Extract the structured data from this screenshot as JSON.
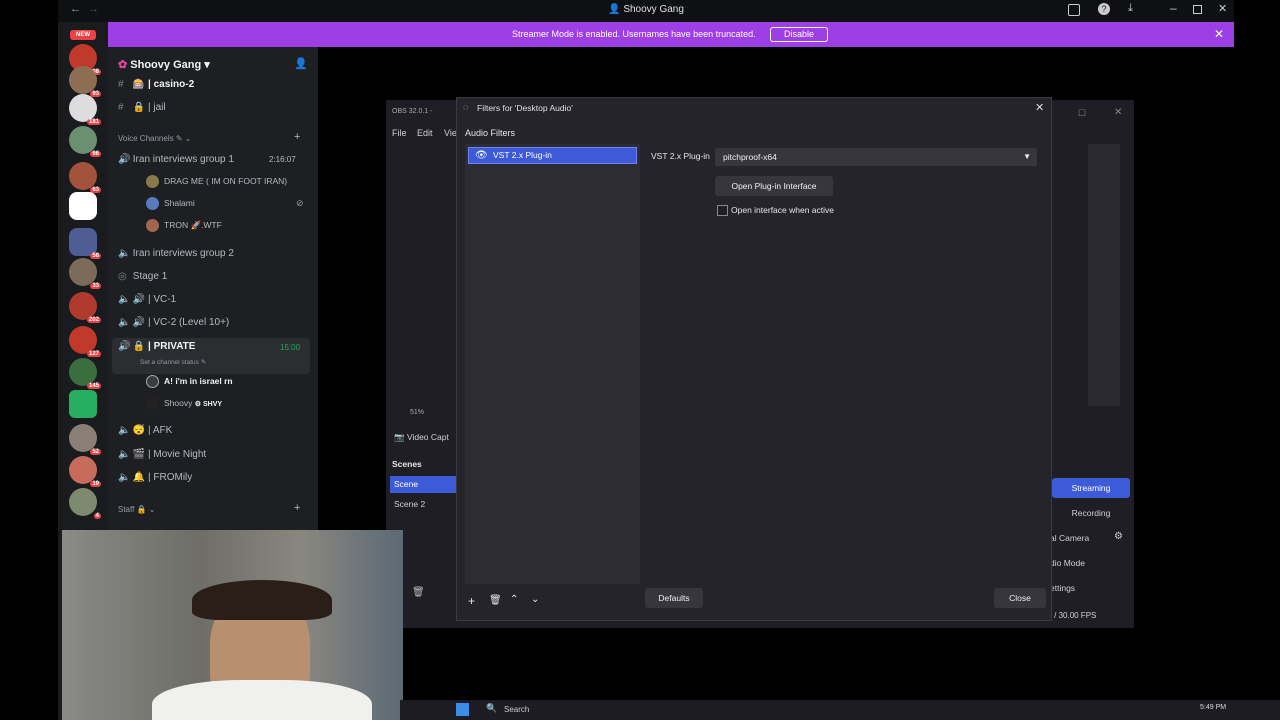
{
  "window": {
    "title": "Shoovy Gang"
  },
  "banner": {
    "text": "Streamer Mode is enabled. Usernames have been truncated.",
    "button": "Disable"
  },
  "rail": {
    "new_label": "NEW",
    "badges": [
      "108",
      "93",
      "181",
      "66",
      "63",
      "58",
      "33",
      "202",
      "127",
      "145",
      "52",
      "19",
      "4"
    ]
  },
  "server": {
    "name": "Shoovy Gang"
  },
  "channels": {
    "text": [
      "| casino-2",
      "| jail"
    ],
    "voice_category": "Voice Channels",
    "voice": [
      {
        "name": "Iran interviews group 1",
        "time": "2:16:07",
        "users": [
          "DRAG ME ( IM ON FOOT IRAN)",
          "Shalami",
          "TRON 🚀.WTF"
        ]
      },
      {
        "name": "Iran interviews group 2"
      },
      {
        "name": "Stage 1"
      },
      {
        "name": "| VC-1"
      },
      {
        "name": "| VC-2 (Level 10+)"
      },
      {
        "name": "| PRIVATE",
        "time": "15:00",
        "status": "Set a channel status",
        "users": [
          "A! i'm in israel rn",
          "Shoovy"
        ],
        "user_tag": "SHVY"
      },
      {
        "name": "| AFK"
      },
      {
        "name": "| Movie Night"
      },
      {
        "name": "| FROMily"
      }
    ],
    "staff_category": "Staff"
  },
  "obs": {
    "title": "OBS 32.0.1 -",
    "menu": [
      "File",
      "Edit",
      "View"
    ],
    "zoom": "51%",
    "source": "Video Capt",
    "scenes_label": "Scenes",
    "scenes": [
      "Scene",
      "Scene 2"
    ],
    "controls": [
      "Streaming",
      "Recording",
      "al Camera",
      "dio Mode",
      "ettings"
    ],
    "fps": "00 / 30.00 FPS"
  },
  "dialog": {
    "title": "Filters for 'Desktop Audio'",
    "section": "Audio Filters",
    "filters": [
      "VST 2.x Plug-in"
    ],
    "plugin_label": "VST 2.x Plug-in",
    "plugin_value": "pitchproof-x64",
    "open_interface": "Open Plug-in Interface",
    "checkbox_label": "Open interface when active",
    "defaults": "Defaults",
    "close": "Close"
  },
  "taskbar": {
    "search": "Search",
    "time": "5:49 PM"
  },
  "colors": {
    "accent": "#3d5bd9",
    "banner": "#9e3fe6",
    "badge": "#ed4245",
    "voice_green": "#23a55a"
  }
}
